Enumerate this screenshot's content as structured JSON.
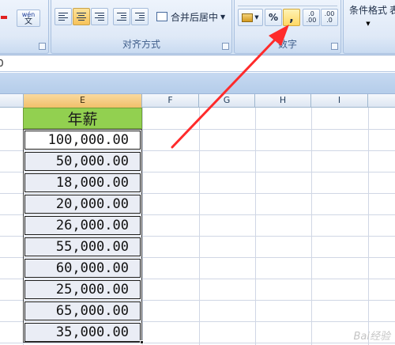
{
  "ribbon": {
    "font_group": {
      "wen_label": "wén",
      "wen_char": "文"
    },
    "alignment_group": {
      "label": "对齐方式",
      "merge_center_label": "合并后居中"
    },
    "number_group": {
      "label": "数字",
      "percent": "%",
      "comma": ",",
      "inc_decimal": ".0\n.00",
      "dec_decimal": ".00\n.0"
    },
    "styles_group": {
      "conditional_format_label": "条件格式",
      "table_label": "表"
    }
  },
  "formula_bar": {
    "content": "0"
  },
  "grid": {
    "columns": [
      "E",
      "F",
      "G",
      "H",
      "I"
    ],
    "selected_column": "E",
    "header": "年薪",
    "values": [
      "100,000.00",
      "50,000.00",
      "18,000.00",
      "20,000.00",
      "26,000.00",
      "55,000.00",
      "60,000.00",
      "25,000.00",
      "65,000.00",
      "35,000.00"
    ]
  },
  "annotation": {
    "arrow_color": "#ff2b2b",
    "target": "comma-style-button"
  },
  "colors": {
    "header_fill": "#92d050",
    "cell_fill": "#eaedf5",
    "highlight": "#ffd863"
  },
  "watermark": {
    "text": "Bai经验"
  }
}
